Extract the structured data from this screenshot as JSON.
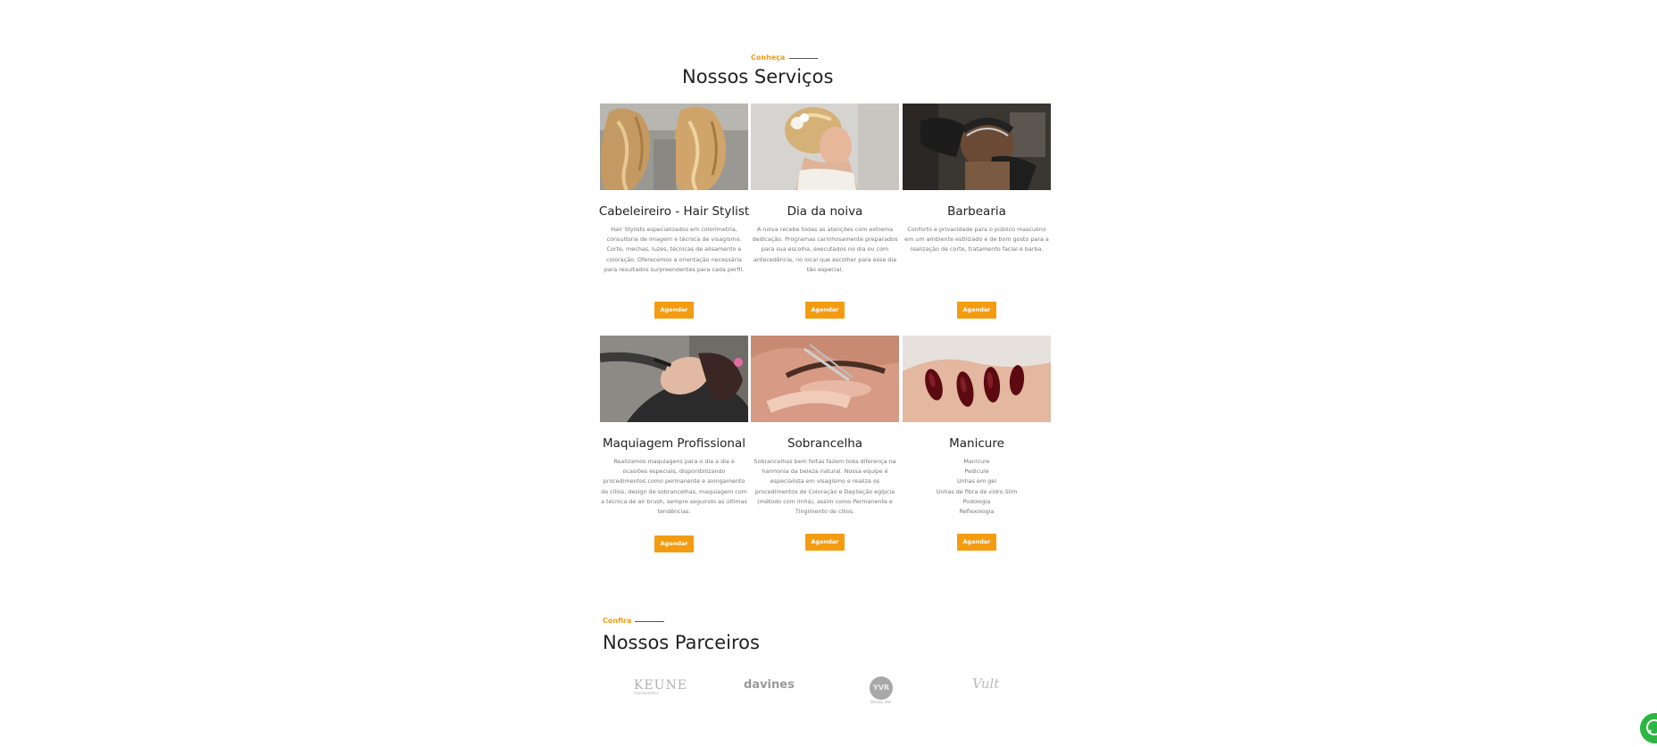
{
  "services": {
    "eyebrow": "Conheça",
    "title": "Nossos Serviços",
    "items": [
      {
        "title": "Cabeleireiro - Hair Stylist",
        "description": "Hair Stylists especializados em colorimetria, consultoria de imagem e técnica de visagismo. Corte, mechas, luzes, técnicas de alisamento e coloração. Oferecemos a orientação necessária para resultados surpreendentes para cada perfil.",
        "button": "Agendar",
        "image": "wavy-blonde-hair-photo"
      },
      {
        "title": "Dia da noiva",
        "description": "A noiva recebe todas as atenções com extrema dedicação. Programas carinhosamente preparados para sua escolha, executados no dia ou com antecedência, no local que escolher para esse dia tão especial.",
        "button": "Agendar",
        "image": "bride-updo-photo"
      },
      {
        "title": "Barbearia",
        "description": "Conforto e privacidade para o público masculino em um ambiente estilizado e de bom gosto para a realização de corte, tratamento facial e barba.",
        "button": "Agendar",
        "image": "barber-haircut-photo"
      },
      {
        "title": "Maquiagem Profissional",
        "description": "Realizamos maquiagens para o dia a dia e ocasiões especiais, disponibilizando procedimentos como permanente e alongamento de cílios, design de sobrancelhas, maquiagem com a técnica de air brush, sempre seguindo as últimas tendências.",
        "button": "Agendar",
        "image": "makeup-application-photo"
      },
      {
        "title": "Sobrancelha",
        "description": "Sobrancelhas bem feitas fazem toda diferença na harmonia da beleza natural. Nossa equipe é especialista em visagismo e realiza os procedimentos de Coloração e Depilação egípcia (método com linha), assim como Permanente e Tingimento de cílios.",
        "button": "Agendar",
        "image": "eyebrow-tweezing-photo"
      },
      {
        "title": "Manicure",
        "description_lines": [
          "Manicure",
          "Pedicure",
          "Unhas em gel",
          "Unhas de fibra de vidro Slim",
          "Podologia",
          "Reflexologia"
        ],
        "button": "Agendar",
        "image": "red-nails-photo"
      }
    ]
  },
  "partners": {
    "eyebrow": "Confira",
    "title": "Nossos Parceiros",
    "logos": [
      {
        "name": "KEUNE",
        "tagline": "haircosmetics"
      },
      {
        "name": "davines"
      },
      {
        "name": "YVR",
        "tagline": "Beauty Hair"
      },
      {
        "name": "Vult"
      }
    ]
  },
  "whatsapp": {
    "icon": "whatsapp-icon"
  },
  "colors": {
    "accent": "#f39c12",
    "title": "#222222",
    "text": "#777777",
    "whatsapp": "#2bb741"
  }
}
